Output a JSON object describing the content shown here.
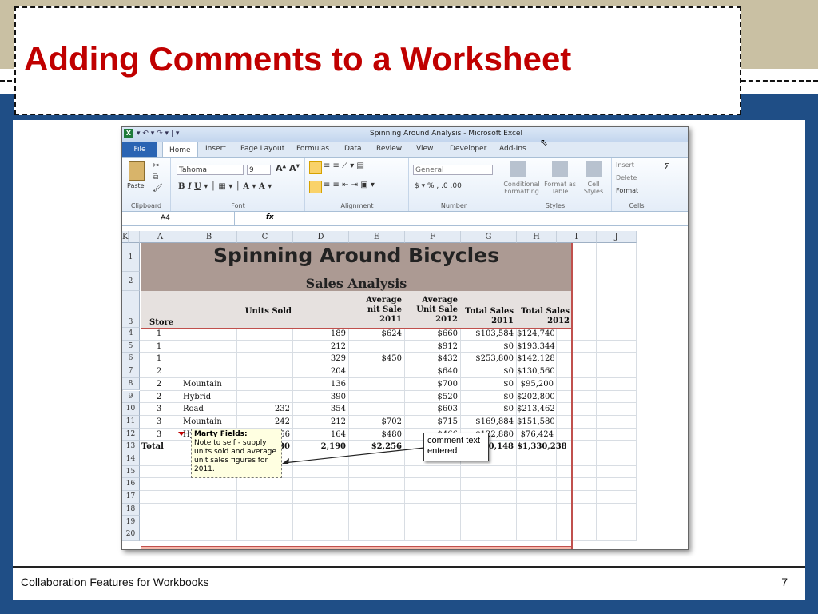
{
  "slide": {
    "title": "Adding Comments to a Worksheet",
    "footer": "Collaboration Features for Workbooks",
    "page": "7",
    "title_color": "#c00000"
  },
  "excel": {
    "window_title": "Spinning Around Analysis - Microsoft Excel",
    "quick_access": "▾ ↶ ▾ ↷ ▾ | ▾",
    "tabs": [
      "File",
      "Home",
      "Insert",
      "Page Layout",
      "Formulas",
      "Data",
      "Review",
      "View",
      "Developer",
      "Add-Ins"
    ],
    "ribbon": {
      "paste": "Paste",
      "font_name": "Tahoma",
      "font_size": "9",
      "number_format": "General",
      "currency_row": "$ ▾ % , .0 .00",
      "conditional": "Conditional Formatting",
      "format_table": "Format as Table",
      "cell_styles": "Cell Styles",
      "insert": "Insert",
      "delete": "Delete",
      "format": "Format",
      "groups": [
        "Clipboard",
        "Font",
        "Alignment",
        "Number",
        "Styles",
        "Cells"
      ]
    },
    "name_box": "A4",
    "fx": "fx",
    "columns": [
      "A",
      "B",
      "C",
      "D",
      "E",
      "F",
      "G",
      "H",
      "I",
      "J",
      "K"
    ],
    "rows": [
      "1",
      "2",
      "3",
      "4",
      "5",
      "6",
      "7",
      "8",
      "9",
      "10",
      "11",
      "12",
      "13",
      "14",
      "15",
      "16",
      "17",
      "18",
      "19",
      "20"
    ],
    "sheet_title": "Spinning Around Bicycles",
    "sheet_subtitle": "Sales Analysis",
    "headers": {
      "store": "Store",
      "units_sold": "Units Sold",
      "avg_2011": [
        "Average",
        "nit Sale",
        "2011"
      ],
      "avg_2012": [
        "Average",
        "Unit Sale",
        "2012"
      ],
      "tot_2011": [
        "Total Sales",
        "2011"
      ],
      "tot_2012": [
        "Total Sales",
        "2012"
      ]
    },
    "data_rows": [
      {
        "a": "1",
        "b": "",
        "c": "",
        "d": "189",
        "e": "$624",
        "f": "$660",
        "g": "$103,584",
        "h": "$124,740"
      },
      {
        "a": "1",
        "b": "",
        "c": "",
        "d": "212",
        "e": "",
        "f": "$912",
        "g": "$0",
        "h": "$193,344"
      },
      {
        "a": "1",
        "b": "",
        "c": "",
        "d": "329",
        "e": "$450",
        "f": "$432",
        "g": "$253,800",
        "h": "$142,128"
      },
      {
        "a": "2",
        "b": "",
        "c": "",
        "d": "204",
        "e": "",
        "f": "$640",
        "g": "$0",
        "h": "$130,560"
      },
      {
        "a": "2",
        "b": "Mountain",
        "c": "",
        "d": "136",
        "e": "",
        "f": "$700",
        "g": "$0",
        "h": "$95,200"
      },
      {
        "a": "2",
        "b": "Hybrid",
        "c": "",
        "d": "390",
        "e": "",
        "f": "$520",
        "g": "$0",
        "h": "$202,800"
      },
      {
        "a": "3",
        "b": "Road",
        "c": "232",
        "d": "354",
        "e": "",
        "f": "$603",
        "g": "$0",
        "h": "$213,462"
      },
      {
        "a": "3",
        "b": "Mountain",
        "c": "242",
        "d": "212",
        "e": "$702",
        "f": "$715",
        "g": "$169,884",
        "h": "$151,580"
      },
      {
        "a": "3",
        "b": "Hybrid",
        "c": "256",
        "d": "164",
        "e": "$480",
        "f": "$466",
        "g": "$122,880",
        "h": "$76,424"
      }
    ],
    "total_row": {
      "a": "Total",
      "c": "730",
      "d": "2,190",
      "e": "$2,256",
      "f": "$5,648",
      "g": "$650,148",
      "h": "$1,330,238"
    },
    "comment": {
      "author": "Marty Fields:",
      "text": "Note to self - supply units sold and average unit sales figures for 2011."
    },
    "callout": "comment text entered",
    "colors": {
      "title_band": "#ac9a93",
      "subtitle_band": "#e6e1df",
      "total_band": "#f4b7aa",
      "border": "#c0504d"
    }
  }
}
